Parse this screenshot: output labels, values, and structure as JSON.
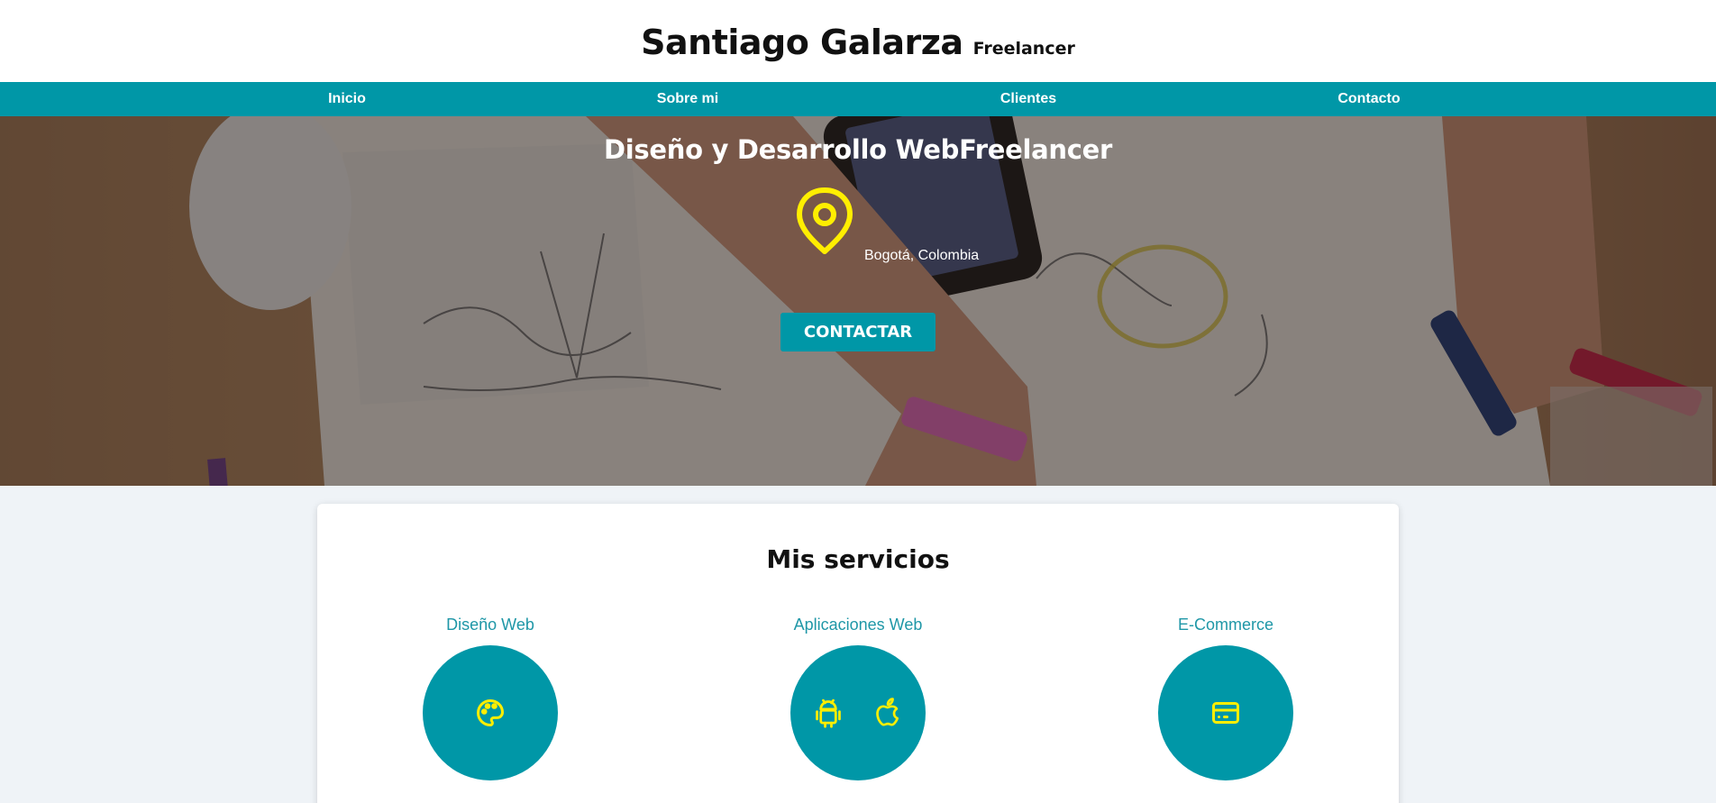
{
  "header": {
    "name": "Santiago Galarza",
    "tagline": "Freelancer"
  },
  "nav": {
    "items": [
      {
        "label": "Inicio"
      },
      {
        "label": "Sobre mi"
      },
      {
        "label": "Clientes"
      },
      {
        "label": "Contacto"
      }
    ]
  },
  "hero": {
    "title": "Diseño y Desarrollo WebFreelancer",
    "location_icon": "map-pin-icon",
    "location": "Bogotá, Colombia",
    "cta_label": "CONTACTAR"
  },
  "services": {
    "title": "Mis servicios",
    "items": [
      {
        "name": "Diseño Web",
        "icons": [
          "palette-icon"
        ]
      },
      {
        "name": "Aplicaciones Web",
        "icons": [
          "android-icon",
          "apple-icon"
        ]
      },
      {
        "name": "E-Commerce",
        "icons": [
          "credit-card-icon"
        ]
      }
    ]
  },
  "colors": {
    "primary": "#0097a7",
    "accent": "#ffee00",
    "text_dark": "#111111",
    "page_bg": "#eff3f7"
  }
}
